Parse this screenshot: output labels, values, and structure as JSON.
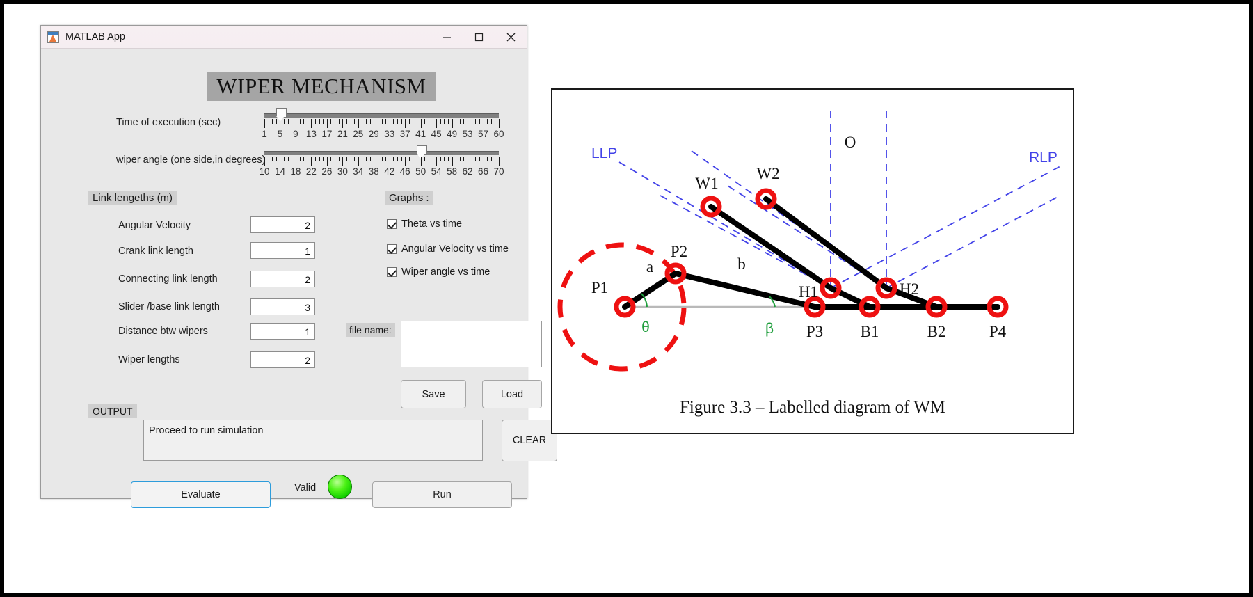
{
  "window": {
    "title": "MATLAB App",
    "icon": "matlab-icon",
    "minimize": "minimize-icon",
    "maximize": "maximize-icon",
    "close": "close-icon"
  },
  "banner": {
    "title": "WIPER MECHANISM"
  },
  "sliders": [
    {
      "label": "Time of execution (sec)",
      "value": 5,
      "min": 1,
      "max": 60,
      "tick_labels": [
        "1",
        "5",
        "9",
        "13",
        "17",
        "21",
        "25",
        "29",
        "33",
        "37",
        "41",
        "45",
        "49",
        "53",
        "57",
        "60"
      ]
    },
    {
      "label": "wiper angle (one side,in degrees)",
      "value": 50,
      "min": 10,
      "max": 70,
      "tick_labels": [
        "10",
        "14",
        "18",
        "22",
        "26",
        "30",
        "34",
        "38",
        "42",
        "46",
        "50",
        "54",
        "58",
        "62",
        "66",
        "70"
      ]
    }
  ],
  "link_section": {
    "header": "Link lengeths (m)",
    "fields": [
      {
        "label": "Angular Velocity",
        "value": "2"
      },
      {
        "label": "Crank link length",
        "value": "1"
      },
      {
        "label": "Connecting link length",
        "value": "2"
      },
      {
        "label": "Slider /base link length",
        "value": "3"
      },
      {
        "label": "Distance btw wipers",
        "value": "1"
      },
      {
        "label": "Wiper lengths",
        "value": "2"
      }
    ]
  },
  "graphs_section": {
    "header": "Graphs :",
    "checkboxes": [
      {
        "label": "Theta vs time",
        "checked": true
      },
      {
        "label": "Angular Velocity vs time",
        "checked": true
      },
      {
        "label": "Wiper angle vs time",
        "checked": true
      }
    ]
  },
  "file_section": {
    "label": "file name:",
    "value": "",
    "placeholder": "",
    "save_label": "Save",
    "load_label": "Load"
  },
  "output_section": {
    "label": "OUTPUT",
    "text": "Proceed to run simulation",
    "clear_label": "CLEAR"
  },
  "actions": {
    "evaluate_label": "Evaluate",
    "valid_label": "Valid",
    "lamp_color": "#22e000",
    "run_label": "Run"
  },
  "figure": {
    "caption": "Figure 3.3 – Labelled diagram of WM",
    "labels": {
      "llp": "LLP",
      "rlp": "RLP",
      "o": "O",
      "w1": "W1",
      "w2": "W2",
      "h1": "H1",
      "h2": "H2",
      "p1": "P1",
      "p2": "P2",
      "p3": "P3",
      "p4": "P4",
      "b1": "B1",
      "b2": "B2",
      "a": "a",
      "b": "b",
      "theta": "θ",
      "beta": "β"
    },
    "colors": {
      "joint": "#ee1111",
      "link": "#000000",
      "guide": "#4242e8",
      "angle": "#1f9e3c",
      "crank_circle": "#ee1111"
    }
  }
}
